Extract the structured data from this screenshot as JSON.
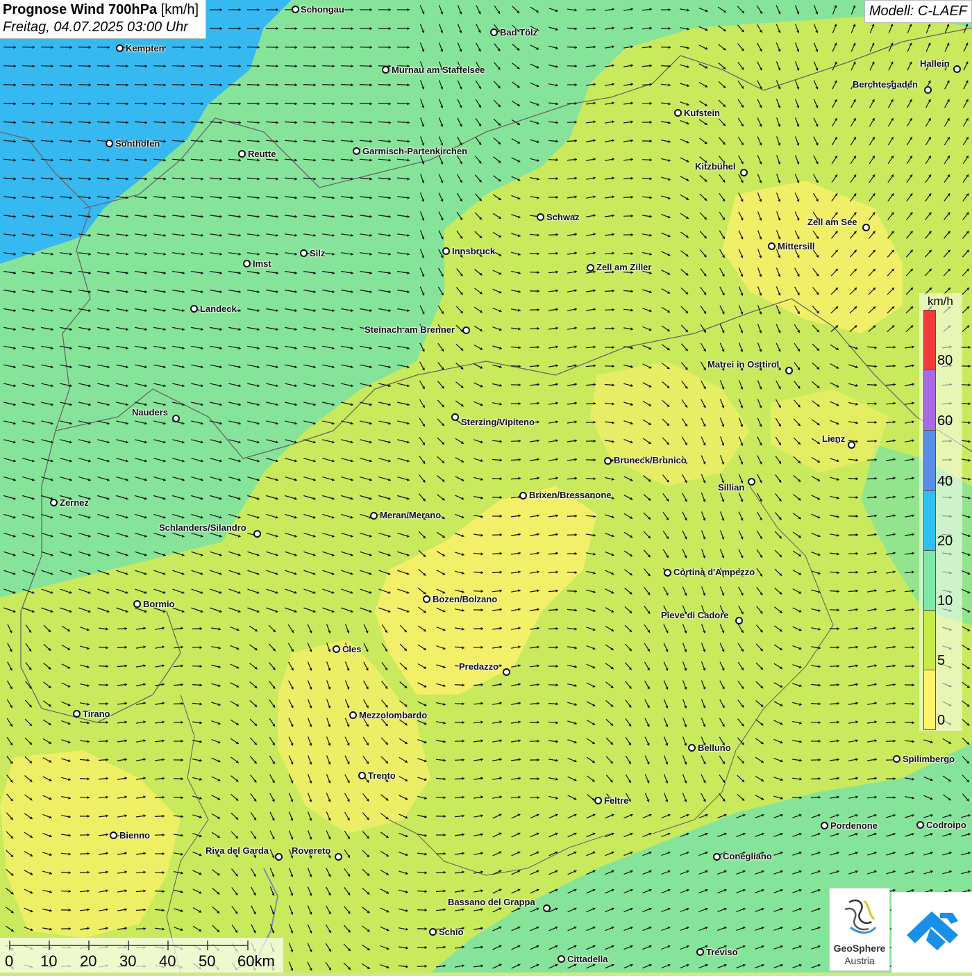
{
  "title": {
    "main": "Prognose Wind 700hPa",
    "unit": "[km/h]",
    "date": "Freitag, 04.07.2025 03:00 Uhr"
  },
  "model": "Modell: C-LAEF",
  "legend": {
    "unit": "km/h",
    "labels": [
      "80",
      "60",
      "40",
      "20",
      "10",
      "5",
      "0"
    ],
    "colors": [
      "#f23b3b",
      "#a86be8",
      "#5b8ee8",
      "#2ec1f0",
      "#7de8a8",
      "#c7ec4a",
      "#fff36a"
    ]
  },
  "scale": {
    "labels": [
      "0",
      "10",
      "20",
      "30",
      "40",
      "50",
      "60km"
    ]
  },
  "colors": {
    "fast": "#35b9f0",
    "mid": "#86e49a",
    "slow": "#c9ea5c",
    "calm": "#fbf06a"
  },
  "cities": [
    {
      "name": "Schongau"
    },
    {
      "name": "Bad Tölz"
    },
    {
      "name": "Kempten"
    },
    {
      "name": "Murnau am Staffelsee"
    },
    {
      "name": "Hallein"
    },
    {
      "name": "Berchtesgaden"
    },
    {
      "name": "Kufstein"
    },
    {
      "name": "Sonthofen"
    },
    {
      "name": "Reutte"
    },
    {
      "name": "Garmisch-Partenkirchen"
    },
    {
      "name": "Kitzbühel"
    },
    {
      "name": "Schwaz"
    },
    {
      "name": "Zell am See"
    },
    {
      "name": "Mittersill"
    },
    {
      "name": "Innsbruck"
    },
    {
      "name": "Silz"
    },
    {
      "name": "Imst"
    },
    {
      "name": "Zell am Ziller"
    },
    {
      "name": "Landeck"
    },
    {
      "name": "Steinach am Brenner"
    },
    {
      "name": "Matrei in Osttirol"
    },
    {
      "name": "Nauders"
    },
    {
      "name": "Sterzing/Vipiteno"
    },
    {
      "name": "Lienz"
    },
    {
      "name": "Bruneck/Brunico"
    },
    {
      "name": "Sillian"
    },
    {
      "name": "Zernez"
    },
    {
      "name": "Brixen/Bressanone"
    },
    {
      "name": "Meran/Merano"
    },
    {
      "name": "Schlanders/Silandro"
    },
    {
      "name": "Cortina d'Ampezzo"
    },
    {
      "name": "Bozen/Bolzano"
    },
    {
      "name": "Bormio"
    },
    {
      "name": "Pieve di Cadore"
    },
    {
      "name": "Cles"
    },
    {
      "name": "Predazzo"
    },
    {
      "name": "Tirano"
    },
    {
      "name": "Mezzolombardo"
    },
    {
      "name": "Belluno"
    },
    {
      "name": "Spilimbergo"
    },
    {
      "name": "Trento"
    },
    {
      "name": "Feltre"
    },
    {
      "name": "Pordenone"
    },
    {
      "name": "Codroipo"
    },
    {
      "name": "Bienno"
    },
    {
      "name": "Riva del Garda"
    },
    {
      "name": "Rovereto"
    },
    {
      "name": "Conegliano"
    },
    {
      "name": "Bassano del Grappa"
    },
    {
      "name": "Schio"
    },
    {
      "name": "Treviso"
    },
    {
      "name": "Cittadella"
    }
  ],
  "logo": {
    "text1": "GeoSphere",
    "text2": "Austria"
  }
}
